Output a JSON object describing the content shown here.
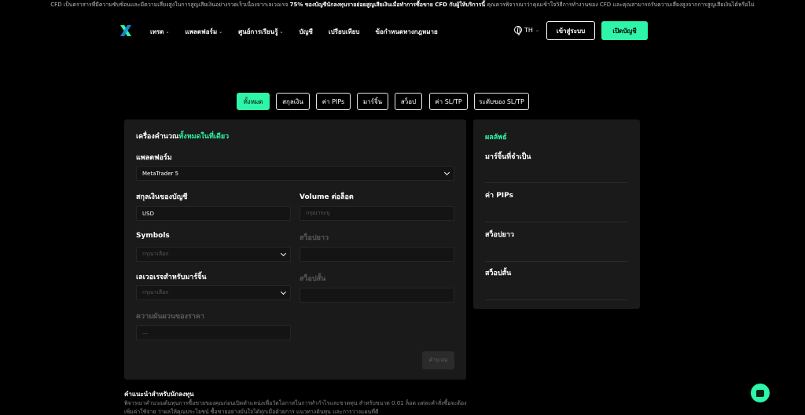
{
  "banner": {
    "text_a": "CFD เป็นตราสารที่มีความซับซ้อนและมีความเสี่ยงสูงในการสูญเสียเงินอย่างรวดเร็วเนื่องจากเลเวอเรจ",
    "text_bold": "75% ของบัญชีนักลงทุนรายย่อยสูญเสียเงินเมื่อทำการซื้อขาย CFD กับผู้ให้บริการนี้",
    "text_b": "คุณควรพิจารณาว่าคุณเข้าใจวิธีการทำงานของ CFD และคุณสามารถรับความเสี่ยงสูงจากการสูญเสียเงินได้หรือไม่"
  },
  "nav": {
    "items": [
      {
        "label": "เทรด",
        "has_dropdown": true
      },
      {
        "label": "แพลตฟอร์ม",
        "has_dropdown": true
      },
      {
        "label": "ศูนย์การเรียนรู้",
        "has_dropdown": true
      },
      {
        "label": "บัญชี",
        "has_dropdown": false
      },
      {
        "label": "เปรียบเทียบ",
        "has_dropdown": false
      },
      {
        "label": "ข้อกำหนดทางกฎหมาย",
        "has_dropdown": false
      }
    ],
    "language": "TH",
    "login_label": "เข้าสู่ระบบ",
    "open_account_label": "เปิดบัญชี"
  },
  "tabs": [
    {
      "label": "ทั้งหมด",
      "active": true
    },
    {
      "label": "สกุลเงิน",
      "active": false
    },
    {
      "label": "ค่า PIPs",
      "active": false
    },
    {
      "label": "มาร์จิ้น",
      "active": false
    },
    {
      "label": "สว็อป",
      "active": false
    },
    {
      "label": "ค่า SL/TP",
      "active": false
    },
    {
      "label": "ระดับของ SL/TP",
      "active": false
    }
  ],
  "calculator": {
    "title_prefix": "เครื่องคำนวณ",
    "title_highlight": "ทั้งหมดในที่เดียว",
    "platform_label": "แพลตฟอร์ม",
    "platform_value": "MetaTrader 5",
    "currency_label": "สกุลเงินของบัญชี",
    "currency_value": "USD",
    "volume_label": "Volume ต่อล็อต",
    "volume_placeholder": "กรุณาระบุ",
    "symbols_label": "Symbols",
    "symbols_placeholder": "กรุณาเลือก",
    "swap_long_label": "สว็อปยาว",
    "leverage_label": "เลเวอเรจสำหรับมาร์จิ้น",
    "leverage_placeholder": "กรุณาเลือก",
    "swap_short_label": "สว็อปสั้น",
    "price_change_label": "ความผันผวนของราคา",
    "price_change_value": "—",
    "calculate_label": "คำนวณ"
  },
  "results": {
    "title": "ผลลัพธ์",
    "margin_label": "มาร์จิ้นที่จำเป็น",
    "pips_label": "ค่า PIPs",
    "swap_long_label": "สว็อปยาว",
    "swap_short_label": "สว็อปสั้น"
  },
  "advice": {
    "title": "คำแนะนำสำหรับนักลงทุน",
    "text": "พิจารณาคำนวณต้นทุนการซื้อขายของคุณก่อนเปิดตำแหน่งเพื่อวัดโอกาสในการทำกำไรและขาดทุน สำหรับขนาด 0.01 ล็อต แต่ละคำสั่งซื้อจะต้องเพิ่มค่าใช้จ่าย ว่าผลให้คุณประโยชน์ ซื้อขายอย่างมั่นใจได้ทุกเมื่อด้วยการ แนวทางต้นทุน และการวางแผนที่ดี"
  },
  "colors": {
    "accent": "#2ef5a8",
    "panel": "#1a1a1a",
    "background": "#000000"
  }
}
